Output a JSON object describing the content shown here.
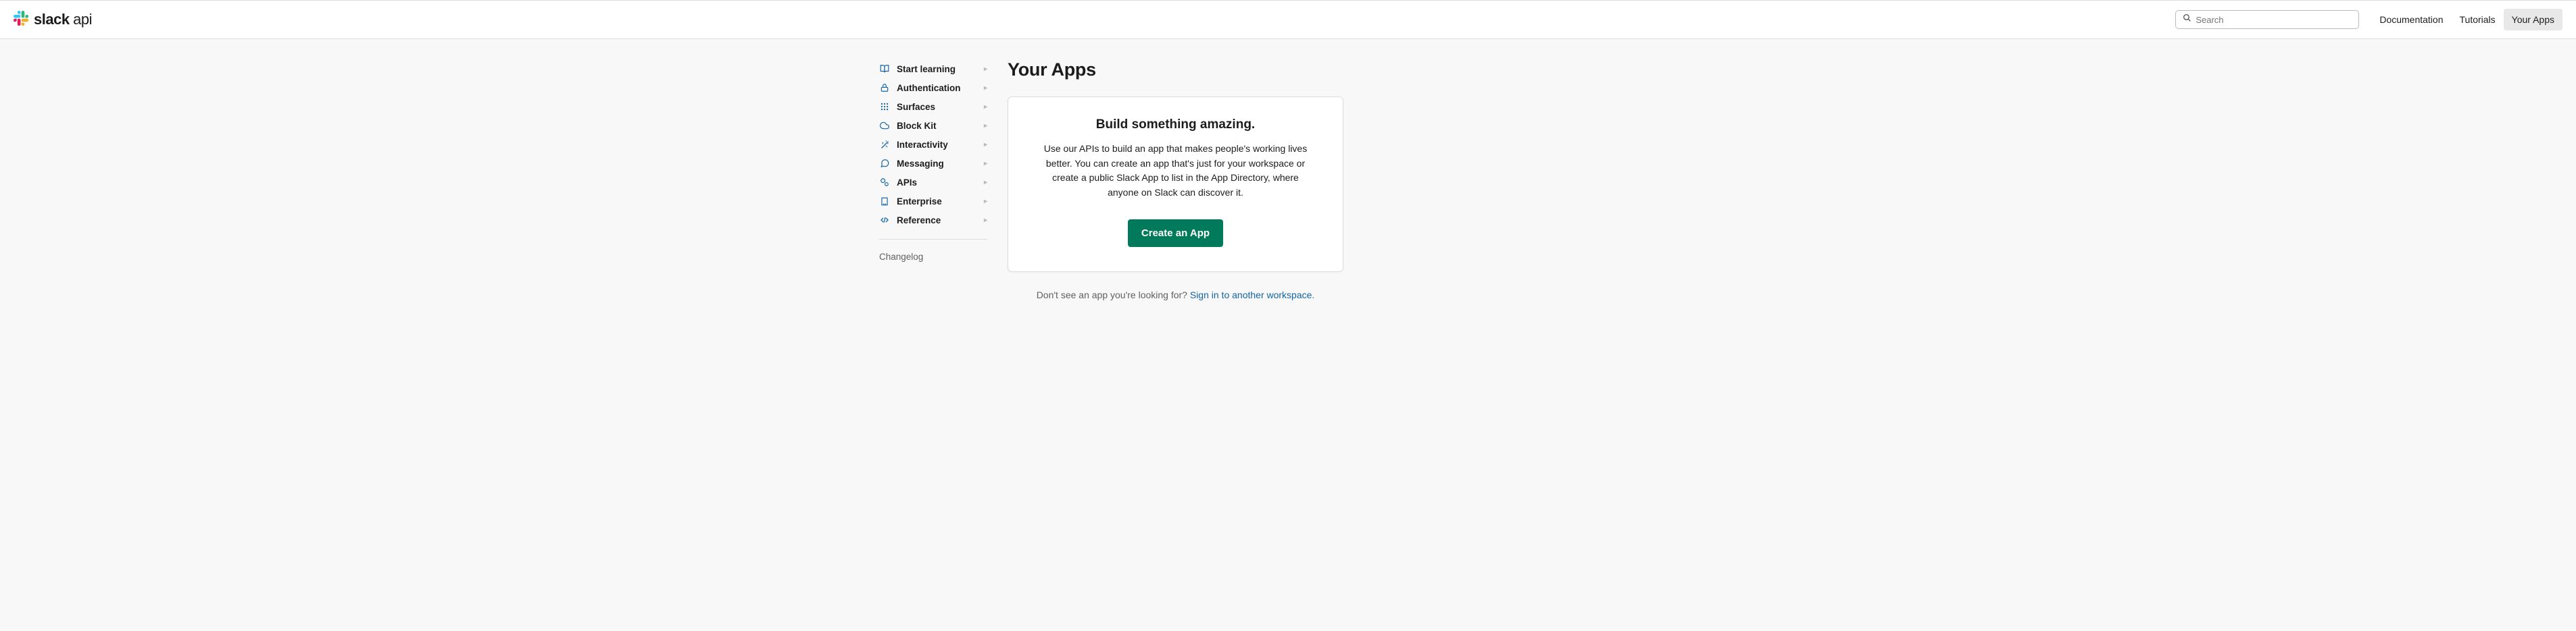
{
  "header": {
    "brand_bold": "slack",
    "brand_light": " api",
    "search_placeholder": "Search",
    "nav": [
      {
        "label": "Documentation",
        "active": false
      },
      {
        "label": "Tutorials",
        "active": false
      },
      {
        "label": "Your Apps",
        "active": true
      }
    ]
  },
  "sidebar": {
    "items": [
      {
        "label": "Start learning",
        "icon": "book"
      },
      {
        "label": "Authentication",
        "icon": "lock"
      },
      {
        "label": "Surfaces",
        "icon": "grid"
      },
      {
        "label": "Block Kit",
        "icon": "cloud"
      },
      {
        "label": "Interactivity",
        "icon": "wand"
      },
      {
        "label": "Messaging",
        "icon": "chat"
      },
      {
        "label": "APIs",
        "icon": "gears"
      },
      {
        "label": "Enterprise",
        "icon": "building"
      },
      {
        "label": "Reference",
        "icon": "code"
      }
    ],
    "extra": "Changelog"
  },
  "main": {
    "title": "Your Apps",
    "card": {
      "heading": "Build something amazing.",
      "body": "Use our APIs to build an app that makes people's working lives better. You can create an app that's just for your workspace or create a public Slack App to list in the App Directory, where anyone on Slack can discover it.",
      "button": "Create an App"
    },
    "below": {
      "prefix": "Don't see an app you're looking for? ",
      "link": "Sign in to another workspace",
      "suffix": "."
    }
  }
}
